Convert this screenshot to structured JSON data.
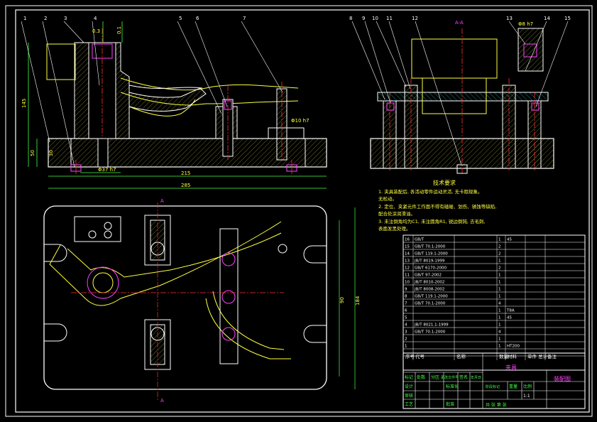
{
  "drawing": {
    "balloons_left": [
      "1",
      "2",
      "3",
      "4",
      "5",
      "6",
      "7"
    ],
    "balloons_right": [
      "8",
      "9",
      "10",
      "11",
      "12",
      "13",
      "14",
      "15"
    ],
    "section_label": "A-A",
    "section_marks": [
      "A",
      "A"
    ],
    "dims": {
      "d_03": "0.3",
      "d_01": "0.1",
      "d_145": "145",
      "d_50": "50",
      "d_30": "30",
      "d_66": "Φ37 h7",
      "d_215": "215",
      "d_285": "285",
      "d_phi10": "Φ10 h7",
      "d_phi8": "Φ8 h7",
      "d_90": "90",
      "d_184": "184"
    }
  },
  "tech": {
    "title": "技术要求",
    "lines": [
      "1. 夹具装配后, 各活动零件运动灵活, 无卡阻现象。",
      "   无松动。",
      "2. 定位、夹紧元件工作面不得有磕碰、划伤、锈蚀等缺陷,",
      "   配合处涂润滑油。",
      "3. 未注倒角均为C1, 未注圆角R1, 锐边倒钝, 去毛刺,",
      "   表面发黑处理。"
    ]
  },
  "parts": [
    {
      "no": "16",
      "code": "GB/T",
      "name": "",
      "qty": "1",
      "mat": "45",
      "note": ""
    },
    {
      "no": "15",
      "code": "GB/T 70.1-2000",
      "name": "",
      "qty": "2",
      "mat": "",
      "note": ""
    },
    {
      "no": "14",
      "code": "GB/T 119.1-2000",
      "name": "",
      "qty": "2",
      "mat": "",
      "note": ""
    },
    {
      "no": "13",
      "code": "JB/T 8019-1999",
      "name": "",
      "qty": "1",
      "mat": "",
      "note": ""
    },
    {
      "no": "12",
      "code": "GB/T 6170-2000",
      "name": "",
      "qty": "2",
      "mat": "",
      "note": ""
    },
    {
      "no": "11",
      "code": "GB/T 97-2002",
      "name": "",
      "qty": "1",
      "mat": "",
      "note": ""
    },
    {
      "no": "10",
      "code": "JB/T 8010-2002",
      "name": "",
      "qty": "1",
      "mat": "",
      "note": ""
    },
    {
      "no": "9",
      "code": "JB/T 8008-2002",
      "name": "",
      "qty": "1",
      "mat": "",
      "note": ""
    },
    {
      "no": "8",
      "code": "GB/T 119.1-2000",
      "name": "",
      "qty": "1",
      "mat": "",
      "note": ""
    },
    {
      "no": "7",
      "code": "GB/T 70.1-2000",
      "name": "",
      "qty": "4",
      "mat": "",
      "note": ""
    },
    {
      "no": "6",
      "code": "",
      "name": "",
      "qty": "1",
      "mat": "T8A",
      "note": ""
    },
    {
      "no": "5",
      "code": "",
      "name": "",
      "qty": "1",
      "mat": "45",
      "note": ""
    },
    {
      "no": "4",
      "code": "JB/T 8021.1-1999",
      "name": "",
      "qty": "1",
      "mat": "",
      "note": ""
    },
    {
      "no": "3",
      "code": "GB/T 70.1-2000",
      "name": "",
      "qty": "4",
      "mat": "",
      "note": ""
    },
    {
      "no": "2",
      "code": "",
      "name": "",
      "qty": "1",
      "mat": "",
      "note": ""
    },
    {
      "no": "1",
      "code": "",
      "name": "",
      "qty": "1",
      "mat": "HT200",
      "note": ""
    }
  ],
  "header": {
    "no": "序号",
    "code": "代号",
    "name": "名称",
    "qty": "数量",
    "mat": "材料",
    "single": "单件 总计",
    "weight": "重量",
    "note": "备注"
  },
  "title_block": {
    "design": "标记",
    "count": "处数",
    "zone": "分区",
    "change": "更改文件号",
    "sign": "签名",
    "date": "年月日",
    "designer": "设计",
    "checker": "审核",
    "process": "工艺",
    "approve": "批准",
    "std": "标准化",
    "drawing_name": "夹具",
    "title": "装配图",
    "stage": "阶段标记",
    "weight": "重量",
    "scale": "比例",
    "scale_val": "1:1",
    "sheets": "共 张 第 张"
  }
}
